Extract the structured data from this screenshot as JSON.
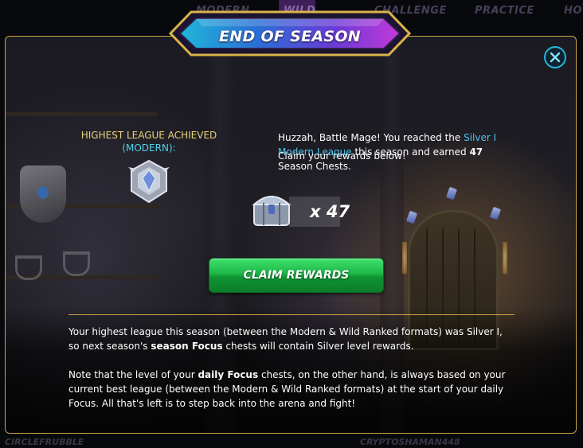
{
  "background_nav": {
    "tabs": [
      "MODERN",
      "WILD",
      "CHALLENGE",
      "PRACTICE",
      "HO"
    ],
    "bottom_left": "CIRCLEFRUBBLE",
    "bottom_center": "CRYPTOSHAMAN448"
  },
  "modal": {
    "title": "END OF SEASON",
    "close_icon": "close-icon",
    "league": {
      "label": "HIGHEST LEAGUE ACHIEVED",
      "format": "(MODERN):",
      "emblem": "silver-league-emblem-icon"
    },
    "description": {
      "part1": "Huzzah, Battle Mage! You reached the ",
      "league_name": "Silver I Modern League",
      "part2": " this season and earned ",
      "chest_count": "47",
      "part3": " Season Chests.",
      "line2": "Claim your rewards below!"
    },
    "chests": {
      "icon": "season-chest-icon",
      "count_text": "x 47"
    },
    "claim_button": "CLAIM REWARDS",
    "note1": {
      "a": "Your highest league this season (between the Modern & Wild Ranked formats) was Silver I, so next season's ",
      "bold": "season Focus",
      "b": " chests will contain Silver level rewards."
    },
    "note2": {
      "a": "Note that the level of your ",
      "bold": "daily Focus",
      "b": " chests, on the other hand, is always based on your current best league (between the Modern & Wild Ranked formats) at the start of your daily Focus. All that's left is to step back into the arena and fight!"
    }
  },
  "colors": {
    "gold_border": "#c9a543",
    "label_gold": "#e8d37a",
    "league_cyan": "#49c3ee",
    "button_green": "#1db64a",
    "close_cyan": "#1fb8d8"
  }
}
